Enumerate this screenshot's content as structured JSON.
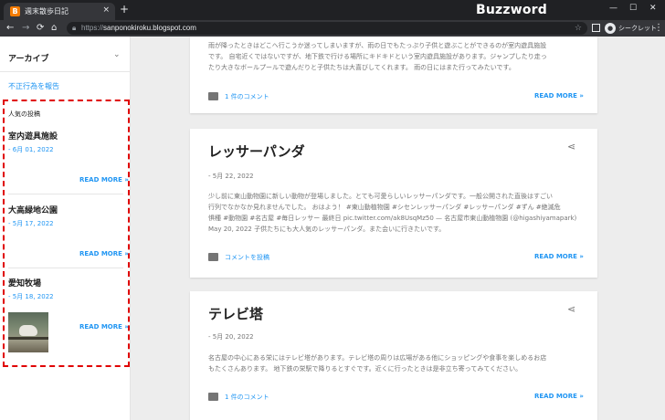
{
  "browser": {
    "tab_title": "週末散歩日記",
    "tab_favicon": "B",
    "tab_close": "×",
    "new_tab": "+",
    "brand_watermark": "Buzzword Inc.",
    "window_controls": {
      "minimize": "—",
      "maximize": "☐",
      "close": "✕"
    },
    "nav": {
      "back": "←",
      "forward": "→",
      "reload": "⟳",
      "home": "⌂"
    },
    "url_prefix": "https://",
    "url_host": "sanponokiroku.blogspot.com",
    "bookmark_icon": "☆",
    "incognito_label": "シークレット",
    "menu_icon": "⋮"
  },
  "sidebar": {
    "archive_label": "アーカイブ",
    "archive_chevron": "⌄",
    "report_link": "不正行為を報告",
    "popular_heading": "人気の投稿",
    "popular_posts": [
      {
        "title": "室内遊具施設",
        "date": "- 6月 01, 2022",
        "read_more": "READ MORE »"
      },
      {
        "title": "大高緑地公園",
        "date": "- 5月 17, 2022",
        "read_more": "READ MORE »"
      },
      {
        "title": "愛知牧場",
        "date": "- 5月 18, 2022",
        "read_more": "READ MORE »"
      }
    ]
  },
  "posts": [
    {
      "body_lines": [
        "雨が降ったときはどこへ行こうか迷ってしまいますが、雨の日でもたっぷり子供と遊ぶことができるのが室内遊具施設",
        "です。 自宅近くではないですが、地下鉄で行ける場所にキドキドという室内遊具施設があります。ジャンプしたり走っ",
        "たり大きなボールプールで遊んだりと子供たちは大喜びしてくれます。 雨の日にはまた行ってみたいです。"
      ],
      "comment_label": "1 件のコメント",
      "read_more": "READ MORE »"
    },
    {
      "title": "レッサーパンダ",
      "date": "- 5月 22, 2022",
      "share_icon": "share-icon",
      "body_lines": [
        "少し前に東山動物園に新しい動物が登場しました。とても可愛らしいレッサーパンダです。一般公開された直後はすごい",
        "行列でなかなか見れませんでした。 おはよう！ #東山動植物園 #シセンレッサーパンダ #レッサーパンダ #ずん #絶滅危",
        "惧種 #動物園 #名古屋 #毎日レッサー 最終日 pic.twitter.com/ak8UsqMz50 — 名古屋市東山動植物園 (@higashiyamapark)",
        "May 20, 2022 子供たちにも大人気のレッサーパンダ。また会いに行きたいです。"
      ],
      "comment_label": "コメントを投稿",
      "read_more": "READ MORE »"
    },
    {
      "title": "テレビ塔",
      "date": "- 5月 20, 2022",
      "share_icon": "share-icon",
      "body_lines": [
        "名古屋の中心にある栄にはテレビ塔があります。テレビ塔の周りは広場がある他にショッピングや食事を楽しめるお店",
        "もたくさんあります。 地下鉄の栄駅で降りるとすぐです。近くに行ったときは是非立ち寄ってみてください。"
      ],
      "comment_label": "1 件のコメント",
      "read_more": "READ MORE »"
    }
  ]
}
